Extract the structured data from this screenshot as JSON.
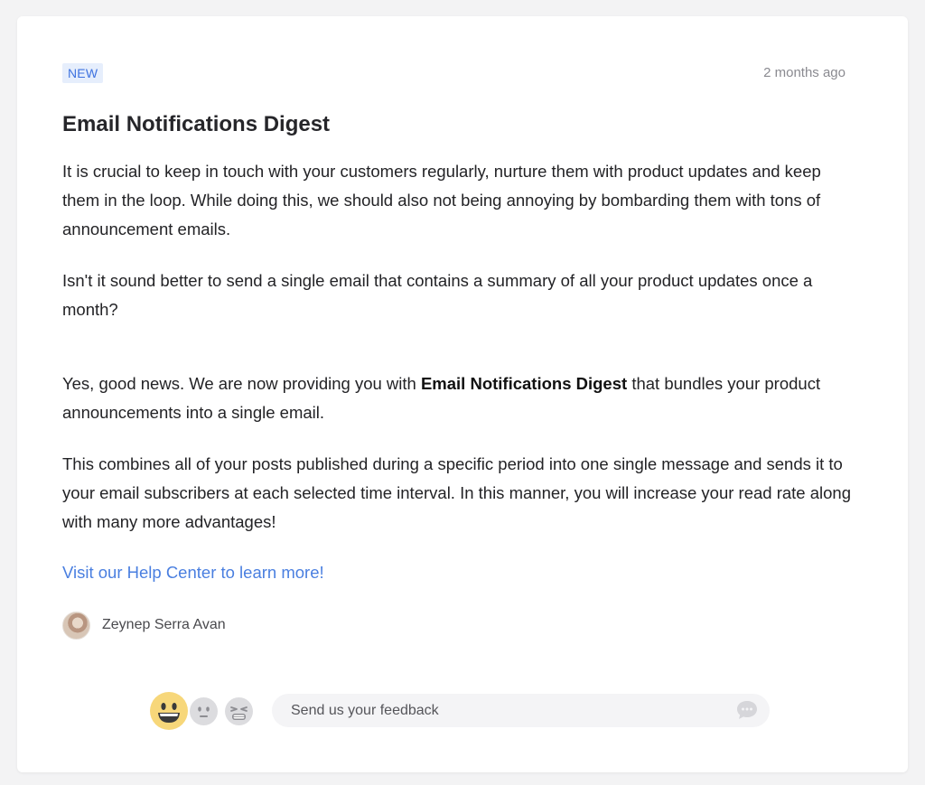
{
  "post": {
    "badge": "NEW",
    "timestamp": "2 months ago",
    "title": "Email Notifications Digest",
    "paragraph1": "It is crucial to keep in touch with your customers regularly, nurture them with product updates and keep them in the loop. While doing this, we should also not being annoying by bombarding them with tons of announcement emails.",
    "paragraph2": "Isn't it sound better to send a single email that contains a summary of all your product updates once a month?",
    "paragraph3_before": "Yes, good news. We are now providing you with ",
    "paragraph3_bold": "Email Notifications Digest",
    "paragraph3_after": " that bundles your product announcements into a single email.",
    "paragraph4": "This combines all of your posts published during a specific period into one single message and sends it to your email subscribers at each selected time interval. In this manner, you will increase your read rate along with many more advantages!",
    "help_link": "Visit our Help Center to learn more!"
  },
  "author": {
    "name": "Zeynep Serra Avan"
  },
  "feedback": {
    "reactions": [
      "happy-face-icon",
      "neutral-face-icon",
      "tired-face-icon"
    ],
    "placeholder": "Send us your feedback",
    "icon": "chat-bubble-icon"
  },
  "colors": {
    "background": "#f3f3f4",
    "badge_bg": "#e6eefc",
    "badge_text": "#3f73e0",
    "link": "#4a7fe0",
    "happy_face": "#f7d77a",
    "inactive_face": "#dcdcdf"
  }
}
